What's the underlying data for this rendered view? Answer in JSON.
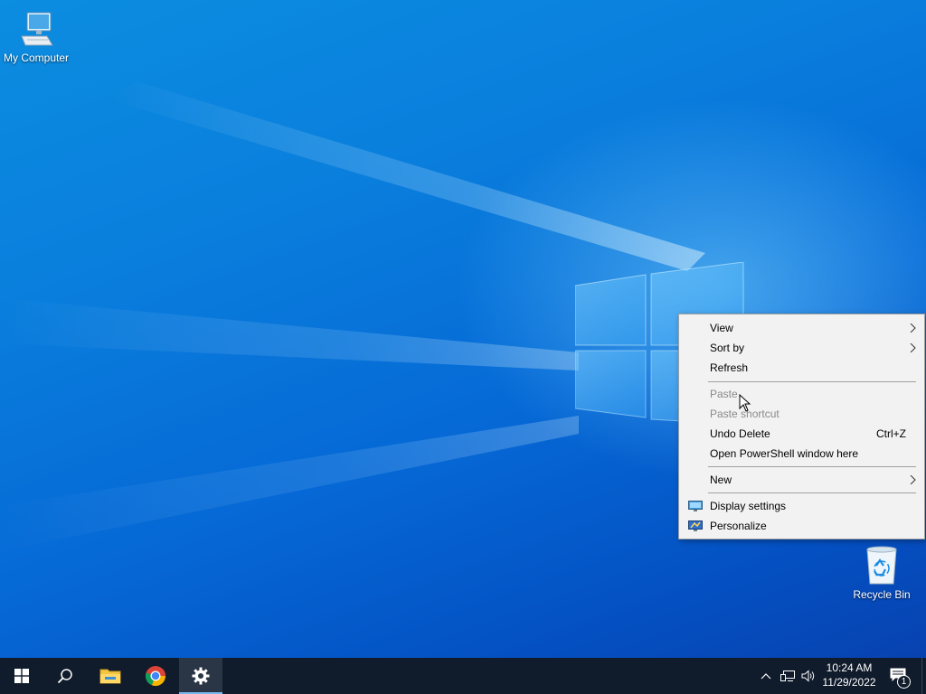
{
  "desktop": {
    "icons": [
      {
        "label": "My Computer",
        "icon": "computer-icon"
      },
      {
        "label": "Recycle Bin",
        "icon": "recycle-bin-icon"
      }
    ]
  },
  "context_menu": {
    "items": [
      {
        "label": "View",
        "submenu": true
      },
      {
        "label": "Sort by",
        "submenu": true
      },
      {
        "label": "Refresh"
      },
      {
        "label": "Paste",
        "disabled": true
      },
      {
        "label": "Paste shortcut",
        "disabled": true
      },
      {
        "label": "Undo Delete",
        "shortcut": "Ctrl+Z"
      },
      {
        "label": "Open PowerShell window here"
      },
      {
        "label": "New",
        "submenu": true
      },
      {
        "label": "Display settings",
        "icon": "display-settings-icon"
      },
      {
        "label": "Personalize",
        "icon": "personalize-icon"
      }
    ]
  },
  "taskbar": {
    "pinned": [
      "start-icon",
      "search-icon",
      "file-explorer-icon",
      "chrome-icon",
      "settings-icon"
    ],
    "active": "settings-icon",
    "clock": {
      "time": "10:24 AM",
      "date": "11/29/2022"
    },
    "notifications_count": "1"
  },
  "colors": {
    "taskbar": "#101b2b",
    "menu_bg": "#f2f2f2",
    "accent": "#76b9ed"
  }
}
